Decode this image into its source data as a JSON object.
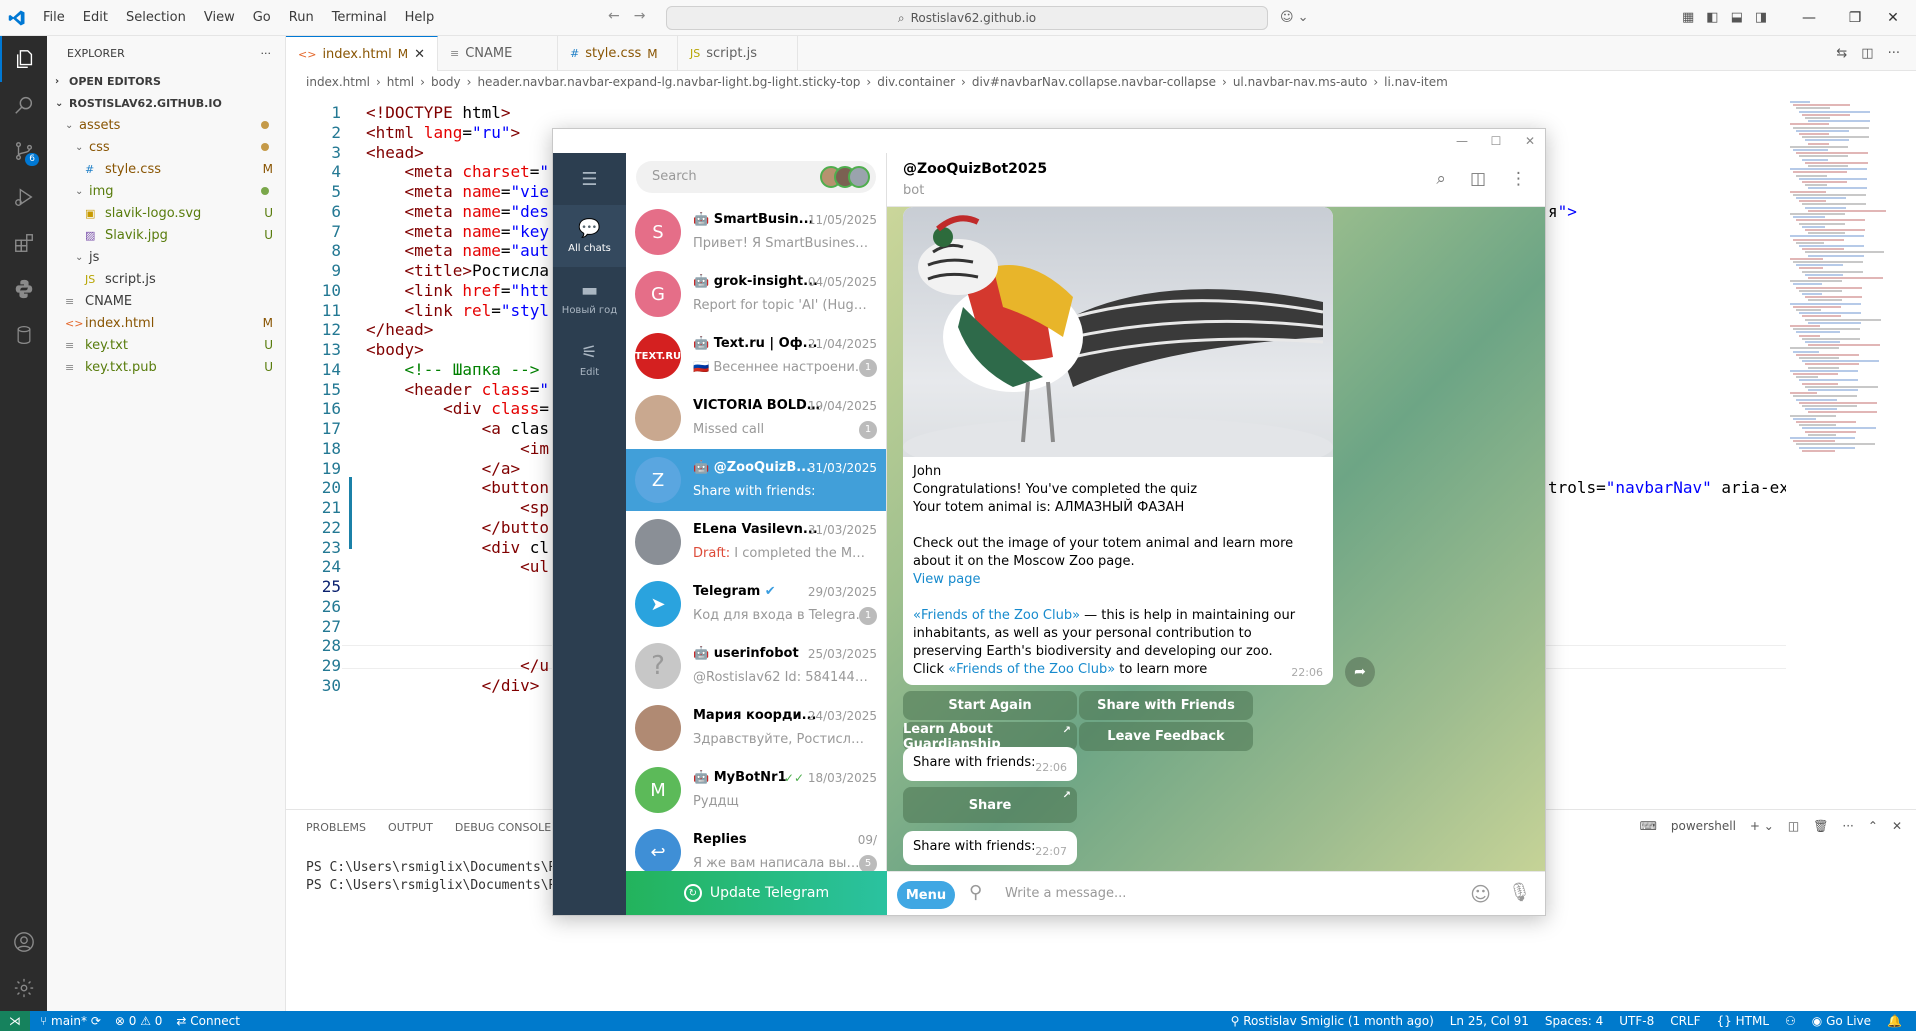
{
  "vscode": {
    "menu": [
      "File",
      "Edit",
      "Selection",
      "View",
      "Go",
      "Run",
      "Terminal",
      "Help"
    ],
    "command_center": "Rostislav62.github.io",
    "explorer_title": "EXPLORER",
    "open_editors": "OPEN EDITORS",
    "root_folder": "ROSTISLAV62.GITHUB.IO",
    "tree": [
      {
        "label": "assets",
        "type": "folder",
        "indent": 1,
        "status": "dot-m"
      },
      {
        "label": "css",
        "type": "folder",
        "indent": 2,
        "status": "dot-m"
      },
      {
        "label": "style.css",
        "type": "css",
        "indent": 3,
        "status": "M"
      },
      {
        "label": "img",
        "type": "folder",
        "indent": 2,
        "status": "dot-u"
      },
      {
        "label": "slavik-logo.svg",
        "type": "svg",
        "indent": 3,
        "status": "U"
      },
      {
        "label": "Slavik.jpg",
        "type": "img",
        "indent": 3,
        "status": "U"
      },
      {
        "label": "js",
        "type": "folder",
        "indent": 2,
        "status": ""
      },
      {
        "label": "script.js",
        "type": "js",
        "indent": 3,
        "status": ""
      },
      {
        "label": "CNAME",
        "type": "text",
        "indent": 1,
        "status": ""
      },
      {
        "label": "index.html",
        "type": "html",
        "indent": 1,
        "status": "M"
      },
      {
        "label": "key.txt",
        "type": "text",
        "indent": 1,
        "status": "U"
      },
      {
        "label": "key.txt.pub",
        "type": "text",
        "indent": 1,
        "status": "U"
      }
    ],
    "tabs": [
      {
        "label": "index.html",
        "mod": "M",
        "active": true
      },
      {
        "label": "CNAME",
        "mod": "",
        "active": false
      },
      {
        "label": "style.css",
        "mod": "M",
        "active": false
      },
      {
        "label": "script.js",
        "mod": "",
        "active": false
      }
    ],
    "breadcrumb": [
      "index.html",
      "html",
      "body",
      "header.navbar.navbar-expand-lg.navbar-light.bg-light.sticky-top",
      "div.container",
      "div#navbarNav.collapse.navbar-collapse",
      "ul.navbar-nav.ms-auto",
      "li.nav-item"
    ],
    "code_lines": [
      "<!DOCTYPE html>",
      "<html lang=\"ru\">",
      "<head>",
      "    <meta charset=\"",
      "    <meta name=\"vie",
      "    <meta name=\"des",
      "    <meta name=\"key",
      "    <meta name=\"aut",
      "    <title>Ростисла",
      "    <link href=\"htt",
      "    <link rel=\"styl",
      "</head>",
      "<body>",
      "    <!-- Шапка -->",
      "    <header class=\"",
      "        <div class=",
      "            <a clas",
      "                <im",
      "            </a>",
      "            <button",
      "                <sp",
      "            </butto",
      "            <div cl",
      "                <ul",
      "",
      "",
      "",
      "",
      "                </u",
      "            </div>"
    ],
    "code_right_fragments": [
      {
        "line": 6,
        "text": "я\">"
      },
      {
        "line": 20,
        "text": "trols=\"navbarNav\" aria-ex"
      }
    ],
    "panel_tabs": [
      "PROBLEMS",
      "OUTPUT",
      "DEBUG CONSOLE"
    ],
    "terminal_label": "powershell",
    "terminal_lines": [
      "PS C:\\Users\\rsmiglix\\Documents\\Rost",
      "PS C:\\Users\\rsmiglix\\Documents\\Rost"
    ],
    "status": {
      "branch": "main*",
      "errors": "0",
      "warnings": "0",
      "connect": "Connect",
      "blame": "Rostislav Smiglic (1 month ago)",
      "position": "Ln 25, Col 91",
      "spaces": "Spaces: 4",
      "encoding": "UTF-8",
      "eol": "CRLF",
      "language": "HTML",
      "golive": "Go Live"
    },
    "scm_badge": "6"
  },
  "telegram": {
    "rail": [
      {
        "label": "All chats",
        "icon": "chat-bubbles-icon",
        "active": true
      },
      {
        "label": "Новый год",
        "icon": "folder-icon",
        "active": false
      },
      {
        "label": "Edit",
        "icon": "sliders-icon",
        "active": false
      }
    ],
    "search_placeholder": "Search",
    "chats": [
      {
        "name": "SmartBusin...",
        "bot": true,
        "date": "11/05/2025",
        "last": "Привет! Я SmartBusinessBot...",
        "avatar_letter": "S",
        "avatar_color": "#e56e88",
        "count": ""
      },
      {
        "name": "grok-insight...",
        "bot": true,
        "date": "04/05/2025",
        "last": "Report for topic 'AI' (Hugging...",
        "avatar_letter": "G",
        "avatar_color": "#e56e88",
        "count": ""
      },
      {
        "name": "Text.ru | Оф...",
        "bot": true,
        "date": "21/04/2025",
        "last": "Весеннее настроени...",
        "avatar_letter": "TEXT.RU",
        "avatar_color": "#d42020",
        "count": "1"
      },
      {
        "name": "VICTORIA BOLD...",
        "bot": false,
        "date": "19/04/2025",
        "last": "Missed call",
        "avatar_letter": "",
        "avatar_color": "#c9a88f",
        "count": "1"
      },
      {
        "name": "@ZooQuizB...",
        "bot": true,
        "date": "31/03/2025",
        "last": "Share with friends:",
        "avatar_letter": "Z",
        "avatar_color": "#5aa6e0",
        "count": "",
        "active": true
      },
      {
        "name": "ELena Vasilevn...",
        "bot": false,
        "date": "31/03/2025",
        "last": "I completed the Mosco...",
        "draft": "Draft:",
        "avatar_letter": "",
        "avatar_color": "#8a8f96",
        "count": ""
      },
      {
        "name": "Telegram",
        "bot": false,
        "verified": true,
        "date": "29/03/2025",
        "last": "Код для входа в Telegra...",
        "avatar_letter": "",
        "avatar_color": "#2aa3de",
        "count": "1"
      },
      {
        "name": "userinfobot",
        "bot": true,
        "date": "25/03/2025",
        "last": "@Rostislav62 Id: 5841448578 ...",
        "avatar_letter": "?",
        "avatar_color": "#c7c7c7",
        "count": ""
      },
      {
        "name": "Мария коорди...",
        "bot": false,
        "date": "24/03/2025",
        "last": "Здравствуйте, Ростислав! М...",
        "avatar_letter": "",
        "avatar_color": "#b08a73",
        "count": ""
      },
      {
        "name": "MyBotNr1",
        "bot": true,
        "read": true,
        "date": "18/03/2025",
        "last": "Руддщ",
        "avatar_letter": "M",
        "avatar_color": "#5cba59",
        "count": ""
      },
      {
        "name": "Replies",
        "bot": false,
        "date": "09/",
        "last": "Я же вам написала выше, с...",
        "avatar_letter": "",
        "avatar_color": "#3f8fd6",
        "count": "5"
      }
    ],
    "update_label": "Update Telegram",
    "header_name": "@ZooQuizBot2025",
    "header_sub": "bot",
    "message": {
      "line1": "John",
      "line2": "Congratulations! You've completed the quiz",
      "line3": "Your totem animal is: АЛМАЗНЫЙ ФАЗАН",
      "line4": "Check out the image of your totem animal and learn more about it on the Moscow Zoo page.",
      "link1": "View page",
      "link2": "«Friends of the Zoo Club»",
      "line5": " — this is help in maintaining our inhabitants, as well as your personal contribution to preserving Earth's biodiversity and developing our zoo.",
      "line6_pre": "Click ",
      "link3": "«Friends of the Zoo Club»",
      "line6_post": " to learn more",
      "time": "22:06"
    },
    "keyboard": [
      {
        "label": "Start Again",
        "arrow": false
      },
      {
        "label": "Share with Friends",
        "arrow": false
      },
      {
        "label": "Learn About Guardianship",
        "arrow": true
      },
      {
        "label": "Leave Feedback",
        "arrow": false
      }
    ],
    "small_msgs": [
      {
        "text": "Share with friends:",
        "time": "22:06"
      },
      {
        "text": "Share with friends:",
        "time": "22:07"
      }
    ],
    "share_button": "Share",
    "menu_button": "Menu",
    "input_placeholder": "Write a message..."
  }
}
